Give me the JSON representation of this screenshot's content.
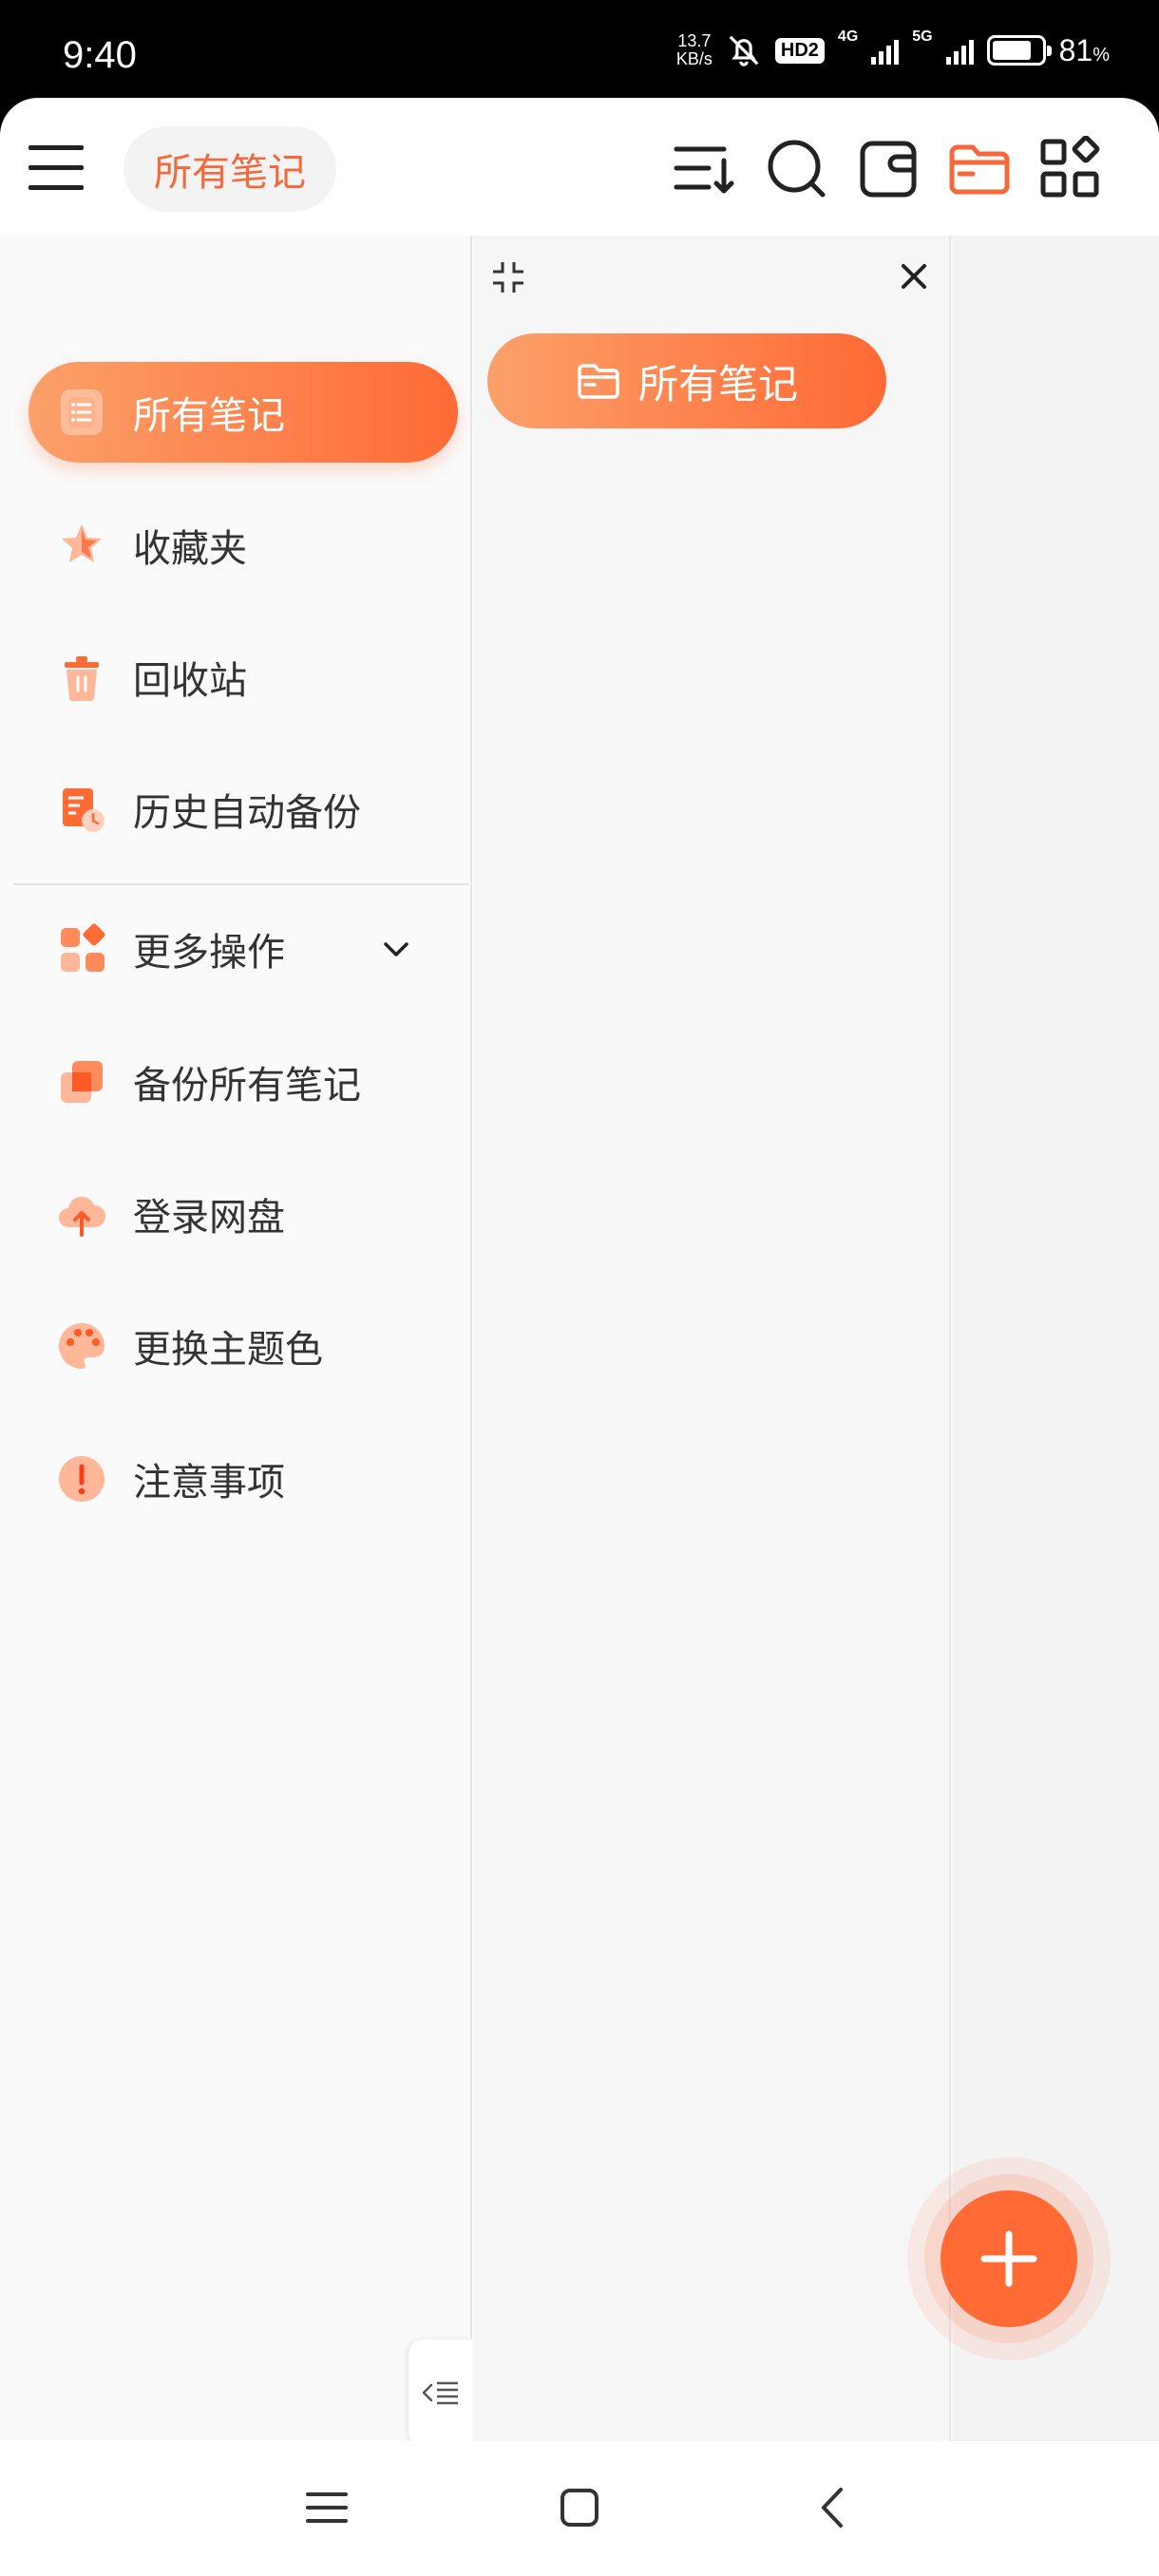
{
  "status_bar": {
    "time": "9:40",
    "speed_value": "13.7",
    "speed_unit": "KB/s",
    "hd_badge": "HD2",
    "net1": "4G",
    "net2": "5G",
    "battery_pct": "81",
    "battery_unit": "%",
    "battery_level": 0.81
  },
  "topbar": {
    "title": "所有笔记",
    "icons": [
      "menu-icon",
      "sort-icon",
      "search-icon",
      "notebook-icon",
      "folder-icon",
      "apps-icon"
    ],
    "accent_color": "#f4683a"
  },
  "drawer": {
    "items": [
      {
        "label": "所有笔记",
        "icon": "notes-list-icon",
        "active": true
      },
      {
        "label": "收藏夹",
        "icon": "star-icon"
      },
      {
        "label": "回收站",
        "icon": "trash-icon"
      },
      {
        "label": "历史自动备份",
        "icon": "history-backup-icon"
      }
    ],
    "more_items": [
      {
        "label": "更多操作",
        "icon": "more-actions-icon",
        "expandable": true
      },
      {
        "label": "备份所有笔记",
        "icon": "backup-icon"
      },
      {
        "label": "登录网盘",
        "icon": "cloud-upload-icon"
      },
      {
        "label": "更换主题色",
        "icon": "palette-icon"
      },
      {
        "label": "注意事项",
        "icon": "notice-icon"
      }
    ]
  },
  "folder_panel": {
    "chip_label": "所有笔记"
  },
  "colors": {
    "gradient_start": "#fba06a",
    "gradient_end": "#ff6a35",
    "fab": "#ff6a35"
  }
}
